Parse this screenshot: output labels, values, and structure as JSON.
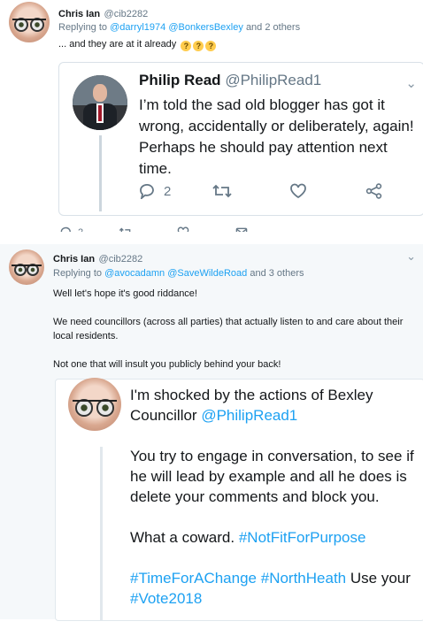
{
  "top_tweet": {
    "name": "Chris Ian",
    "handle": "@cib2282",
    "replying_prefix": "Replying to",
    "replying_to_1": "@darryl1974",
    "replying_to_2": "@BonkersBexley",
    "replying_suffix": "and 2 others",
    "text": "... and they are at it already",
    "emoji": "thinking-face-emoji",
    "quoted": {
      "name": "Philip Read",
      "handle": "@PhilipRead1",
      "text": "I’m told the sad old blogger has got it wrong, accidentally or deliberately, again! Perhaps he should pay attention next time.",
      "reply_count": "2"
    },
    "actions": {
      "reply_count": "2"
    }
  },
  "bottom_tweet": {
    "name": "Chris Ian",
    "handle": "@cib2282",
    "replying_prefix": "Replying to",
    "replying_to_1": "@avocadamn",
    "replying_to_2": "@SaveWildeRoad",
    "replying_suffix": "and 3 others",
    "paragraph_1": "Well let's hope it's good riddance!",
    "paragraph_2": "We need councillors (across all parties) that actually listen to and care about their local residents.",
    "paragraph_3": "Not one that will insult you publicly behind your back!",
    "image_text": {
      "line1_prefix": "I'm shocked by the actions of Bexley Councillor",
      "line1_mention": "@PhilipRead1",
      "para2": "You try to engage in conversation, to see if he will lead by example and all he does is delete your comments and block you.",
      "para3_prefix": "What a coward.",
      "para3_tag": "#NotFitForPurpose",
      "tag1": "#TimeForAChange",
      "tag2": "#NorthHeath",
      "use_your": "Use your",
      "tag3": "#Vote2018"
    }
  },
  "colors": {
    "link": "#1da1f2",
    "muted": "#657786",
    "text": "#14171a"
  }
}
